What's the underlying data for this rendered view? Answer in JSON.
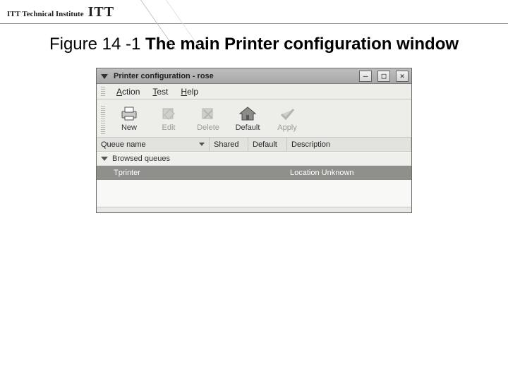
{
  "page": {
    "logo_small": "ITT Technical Institute",
    "logo_big": "ITT",
    "caption_prefix": "Figure 14 -1 ",
    "caption_bold": "The main Printer configuration window"
  },
  "window": {
    "title": "Printer configuration - rose",
    "controls": {
      "minimize": "–",
      "maximize": "□",
      "close": "✕"
    },
    "menu": {
      "action": {
        "ul": "A",
        "rest": "ction"
      },
      "test": {
        "ul": "T",
        "rest": "est"
      },
      "help": {
        "ul": "H",
        "rest": "elp"
      }
    },
    "toolbar": {
      "new": {
        "label": "New",
        "icon": "printer-icon"
      },
      "edit": {
        "label": "Edit",
        "icon": "edit-icon"
      },
      "delete": {
        "label": "Delete",
        "icon": "delete-icon"
      },
      "default": {
        "label": "Default",
        "icon": "home-icon"
      },
      "apply": {
        "label": "Apply",
        "icon": "apply-icon"
      }
    },
    "columns": {
      "queue": "Queue name",
      "shared": "Shared",
      "default": "Default",
      "desc": "Description"
    },
    "list": {
      "category": "Browsed queues",
      "rows": [
        {
          "name": "Tprinter",
          "shared": "",
          "default": "",
          "desc": "Location Unknown"
        }
      ]
    }
  }
}
